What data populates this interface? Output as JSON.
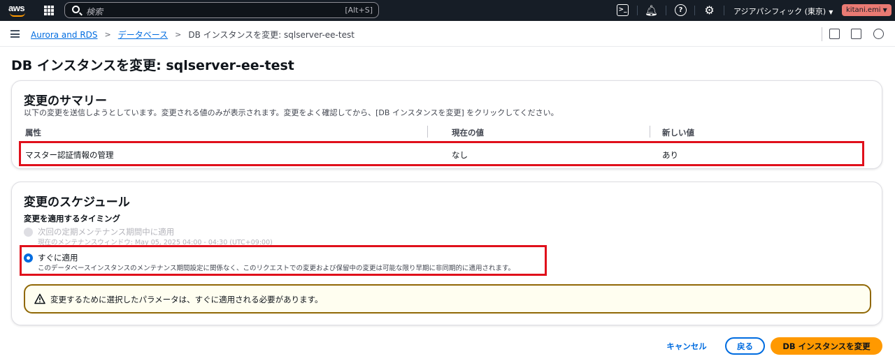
{
  "topnav": {
    "logo": "aws",
    "search": {
      "placeholder": "検索",
      "shortcut": "[Alt+S]"
    },
    "region": "アジアパシフィック (東京)",
    "user": "kitani.emi",
    "icons": [
      "cloudshell-icon",
      "bell-icon",
      "help-icon",
      "gear-icon"
    ]
  },
  "breadcrumb": {
    "items": [
      "Aurora and RDS",
      "データベース",
      "DB インスタンスを変更: sqlserver-ee-test"
    ]
  },
  "page": {
    "title": "DB インスタンスを変更: sqlserver-ee-test"
  },
  "summary": {
    "title": "変更のサマリー",
    "description": "以下の変更を送信しようとしています。変更される値のみが表示されます。変更をよく確認してから、[DB インスタンスを変更] をクリックしてください。",
    "columns": [
      "属性",
      "現在の値",
      "新しい値"
    ],
    "rows": [
      {
        "attribute": "マスター認証情報の管理",
        "current": "なし",
        "new": "あり"
      }
    ]
  },
  "schedule": {
    "title": "変更のスケジュール",
    "timing_label": "変更を適用するタイミング",
    "options": [
      {
        "label": "次回の定期メンテナンス期間中に適用",
        "description": "現在のメンテナンスウィンドウ: May 05, 2025 04:00 - 04:30 (UTC+09:00)",
        "state": "disabled"
      },
      {
        "label": "すぐに適用",
        "description": "このデータベースインスタンスのメンテナンス期間設定に関係なく、このリクエストでの変更および保留中の変更は可能な限り早期に非同期的に適用されます。",
        "state": "checked"
      }
    ],
    "alert": "変更するために選択したパラメータは、すぐに適用される必要があります。"
  },
  "footer": {
    "cancel": "キャンセル",
    "back": "戻る",
    "submit": "DB インスタンスを変更"
  },
  "colors": {
    "accent": "#006ce0",
    "primary_button": "#ff9900",
    "highlight": "#e0101b",
    "warning": "#906806"
  }
}
